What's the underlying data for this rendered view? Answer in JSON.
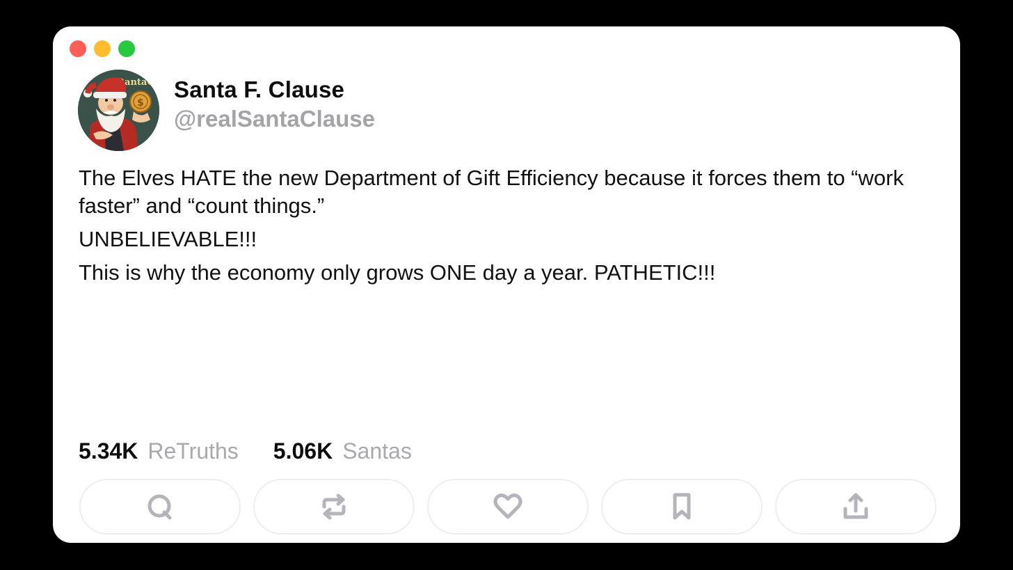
{
  "window": {
    "controls": {
      "close_color": "#ff5f57",
      "minimize_color": "#febc2e",
      "maximize_color": "#28c840"
    }
  },
  "author": {
    "name": "Santa F. Clause",
    "handle": "@realSantaClause",
    "avatar_text": "$antaCoin"
  },
  "post": {
    "paragraphs": [
      "The Elves HATE the new Department of Gift Efficiency because it forces them to “work faster” and “count things.”",
      "UNBELIEVABLE!!!",
      "This is why the economy only grows ONE day a year. PATHETIC!!!"
    ]
  },
  "stats": {
    "retruths_count": "5.34K",
    "retruths_label": "ReTruths",
    "santas_count": "5.06K",
    "santas_label": "Santas"
  },
  "actions": [
    {
      "icon": "reply-icon"
    },
    {
      "icon": "retruth-icon"
    },
    {
      "icon": "heart-icon"
    },
    {
      "icon": "bookmark-icon"
    },
    {
      "icon": "share-icon"
    }
  ],
  "colors": {
    "icon_gray": "#b4b4ba",
    "muted_text": "#a4a4a8"
  }
}
